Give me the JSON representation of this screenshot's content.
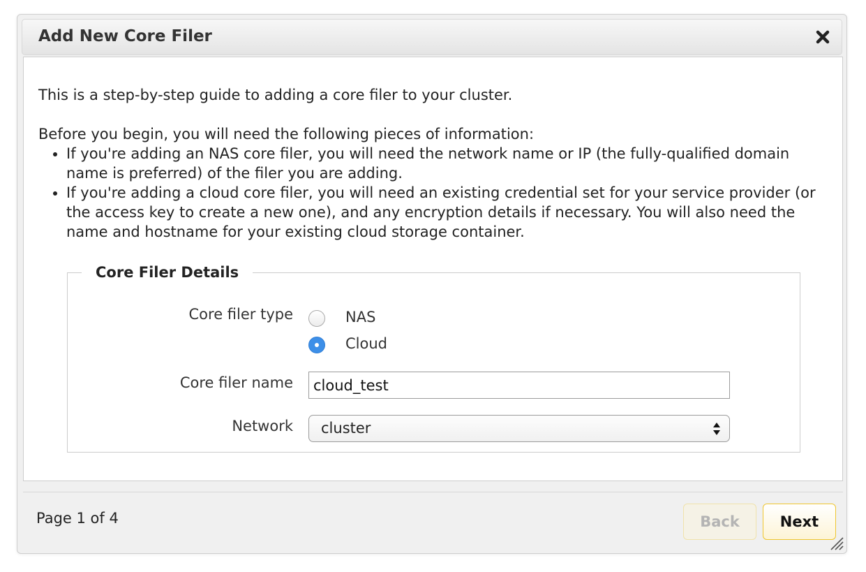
{
  "dialog": {
    "title": "Add New Core Filer",
    "close_icon": "close-icon"
  },
  "content": {
    "intro": "This is a step-by-step guide to adding a core filer to your cluster.",
    "before": "Before you begin, you will need the following pieces of information:",
    "requirements": [
      "If you're adding an NAS core filer, you will need the network name or IP (the fully-qualified domain name is preferred) of the filer you are adding.",
      "If you're adding a cloud core filer, you will need an existing credential set for your service provider (or the access key to create a new one), and any encryption details if necessary. You will also need the name and hostname for your existing cloud storage container."
    ]
  },
  "details": {
    "legend": "Core Filer Details",
    "type_label": "Core filer type",
    "type_options": [
      {
        "label": "NAS",
        "selected": false
      },
      {
        "label": "Cloud",
        "selected": true
      }
    ],
    "name_label": "Core filer name",
    "name_value": "cloud_test",
    "network_label": "Network",
    "network_value": "cluster"
  },
  "footer": {
    "page_status": "Page 1 of 4",
    "back_label": "Back",
    "next_label": "Next",
    "back_enabled": false
  },
  "colors": {
    "radio_selected": "#3d8fe8",
    "button_border": "#efc62e"
  }
}
